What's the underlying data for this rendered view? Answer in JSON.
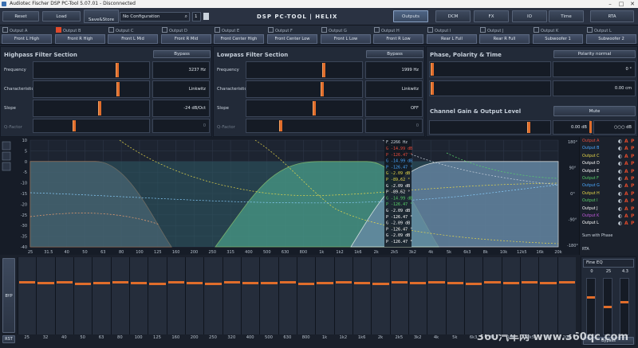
{
  "window": {
    "title": "Audiotec Fischer DSP PC-Tool 5.07.01 - Disconnected"
  },
  "toolbar": {
    "reset": "Reset",
    "load": "Load",
    "save_store": "Save&Store",
    "config_value": "No Configuration",
    "config_num": "1",
    "logo": "DSP PC-TOOL | HELIX"
  },
  "nav_tabs": [
    "Outputs",
    "DCM",
    "FX",
    "IO",
    "Time",
    "RTA"
  ],
  "outputs": [
    {
      "id": "Output A",
      "name": "Front L High",
      "on": false
    },
    {
      "id": "Output B",
      "name": "Front R High",
      "on": true
    },
    {
      "id": "Output C",
      "name": "Front L Mid",
      "on": false
    },
    {
      "id": "Output D",
      "name": "Front R Mid",
      "on": false
    },
    {
      "id": "Output E",
      "name": "Front Center High",
      "on": false
    },
    {
      "id": "Output F",
      "name": "Front Center Low",
      "on": false
    },
    {
      "id": "Output G",
      "name": "Front L Low",
      "on": false
    },
    {
      "id": "Output H",
      "name": "Front R Low",
      "on": false
    },
    {
      "id": "Output I",
      "name": "Rear L Full",
      "on": false
    },
    {
      "id": "Output J",
      "name": "Rear R Full",
      "on": false
    },
    {
      "id": "Output K",
      "name": "Subwoofer 1",
      "on": false
    },
    {
      "id": "Output L",
      "name": "Subwoofer 2",
      "on": false
    }
  ],
  "highpass": {
    "title": "Highpass Filter Section",
    "bypass": "Bypass",
    "rows": [
      {
        "label": "Frequency",
        "value": "3237 Hz"
      },
      {
        "label": "Characteristic",
        "value": "Linkwitz"
      },
      {
        "label": "Slope",
        "value": "-24 dB/Oct"
      },
      {
        "label": "Q-Factor",
        "value": "0"
      }
    ]
  },
  "lowpass": {
    "title": "Lowpass Filter Section",
    "bypass": "Bypass",
    "rows": [
      {
        "label": "Frequency",
        "value": "1999 Hz"
      },
      {
        "label": "Characteristic",
        "value": "Linkwitz"
      },
      {
        "label": "Slope",
        "value": "OFF"
      },
      {
        "label": "Q-Factor",
        "value": "0"
      }
    ]
  },
  "phase": {
    "title": "Phase, Polarity & Time",
    "polarity": "Polarity normal",
    "phase_value": "0 °",
    "time_value": "0.00 cm"
  },
  "gain": {
    "title": "Channel Gain & Output Level",
    "mute": "Mute",
    "value": "0.00 dB",
    "level": "○○○ dB"
  },
  "graph": {
    "y_left": [
      "10",
      "5",
      "0",
      "-5",
      "-10",
      "-15",
      "-20",
      "-25",
      "-30",
      "-35",
      "-40"
    ],
    "y_right": [
      "180°",
      "90°",
      "0°",
      "-90°",
      "-180°"
    ],
    "x_ticks": [
      "25",
      "31.5",
      "40",
      "50",
      "63",
      "80",
      "100",
      "125",
      "160",
      "200",
      "250",
      "315",
      "400",
      "500",
      "630",
      "800",
      "1k",
      "1k2",
      "1k6",
      "2k",
      "2k5",
      "3k2",
      "4k",
      "5k",
      "6k3",
      "8k",
      "10k",
      "12k5",
      "16k",
      "20k"
    ],
    "readout_header": "F   2266 Hz",
    "readout": [
      {
        "k": "G",
        "v": "-14.99 dB",
        "c": "#e94b3c"
      },
      {
        "k": "P",
        "v": "-126.47 °",
        "c": "#e94b3c"
      },
      {
        "k": "G",
        "v": "-14.99 dB",
        "c": "#4aa8ff"
      },
      {
        "k": "P",
        "v": "-126.47 °",
        "c": "#4aa8ff"
      },
      {
        "k": "G",
        "v": "-2.09 dB",
        "c": "#e8d94a"
      },
      {
        "k": "P",
        "v": "-89.62 °",
        "c": "#e8d94a"
      },
      {
        "k": "G",
        "v": "-2.09 dB",
        "c": "#ffffff"
      },
      {
        "k": "P",
        "v": "-89.62 °",
        "c": "#ffffff"
      },
      {
        "k": "G",
        "v": "-14.99 dB",
        "c": "#59d36a"
      },
      {
        "k": "P",
        "v": "-126.47 °",
        "c": "#59d36a"
      },
      {
        "k": "G",
        "v": "-2.09 dB",
        "c": "#ffffff"
      },
      {
        "k": "P",
        "v": "-126.47 °",
        "c": "#ffffff"
      },
      {
        "k": "G",
        "v": "-2.09 dB",
        "c": "#ffffff"
      },
      {
        "k": "P",
        "v": "-126.47 °",
        "c": "#ffffff"
      },
      {
        "k": "G",
        "v": "-2.09 dB",
        "c": "#ffffff"
      },
      {
        "k": "P",
        "v": "-126.47 °",
        "c": "#ffffff"
      }
    ]
  },
  "channel_list": [
    {
      "name": "Output A",
      "c": "#e94b3c"
    },
    {
      "name": "Output B",
      "c": "#4aa8ff"
    },
    {
      "name": "Output C",
      "c": "#e8d94a"
    },
    {
      "name": "Output D",
      "c": "#ffffff"
    },
    {
      "name": "Output E",
      "c": "#ffffff"
    },
    {
      "name": "Output F",
      "c": "#59d36a"
    },
    {
      "name": "Output G",
      "c": "#4aa8ff"
    },
    {
      "name": "Output H",
      "c": "#e8d94a"
    },
    {
      "name": "Output I",
      "c": "#59d36a"
    },
    {
      "name": "Output J",
      "c": "#ffffff"
    },
    {
      "name": "Output K",
      "c": "#c25adf"
    },
    {
      "name": "Output L",
      "c": "#ffffff"
    }
  ],
  "side_labels": {
    "sum": "Sum with Phase",
    "rta": "RTA"
  },
  "eq": {
    "byp": "BYP",
    "rst": "RST",
    "bands": [
      "25",
      "32",
      "40",
      "50",
      "63",
      "80",
      "100",
      "125",
      "160",
      "200",
      "250",
      "320",
      "400",
      "500",
      "630",
      "800",
      "1k",
      "1k2",
      "1k6",
      "2k",
      "2k5",
      "3k2",
      "4k",
      "5k",
      "6k3",
      "8k",
      "10k",
      "12k5",
      "16k",
      "20k"
    ],
    "fine_title": "Fine EQ",
    "fine_values": [
      "0",
      "25",
      "4.3"
    ],
    "fine_bypass": "Bypass"
  },
  "watermark": "360汽车网 www.360qc.com"
}
